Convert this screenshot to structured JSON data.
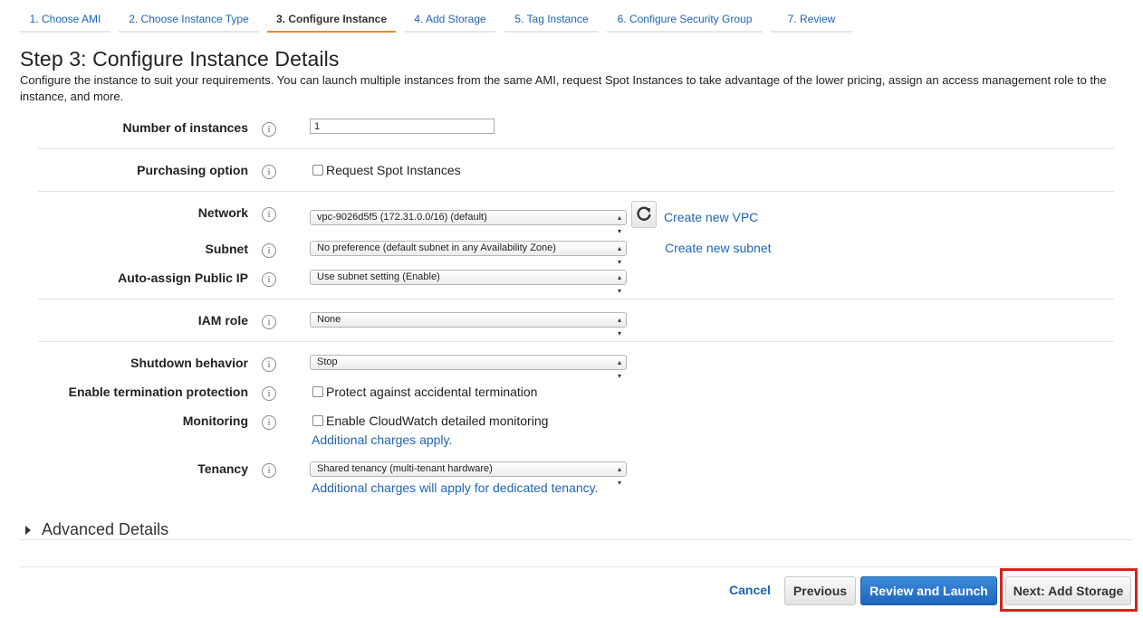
{
  "wizard": {
    "steps": [
      {
        "label": "1. Choose AMI"
      },
      {
        "label": "2. Choose Instance Type"
      },
      {
        "label": "3. Configure Instance"
      },
      {
        "label": "4. Add Storage"
      },
      {
        "label": "5. Tag Instance"
      },
      {
        "label": "6. Configure Security Group"
      },
      {
        "label": "7. Review"
      }
    ],
    "active_step": 3
  },
  "page": {
    "title": "Step 3: Configure Instance Details",
    "intro": "Configure the instance to suit your requirements. You can launch multiple instances from the same AMI, request Spot Instances to take advantage of the lower pricing, assign an access management role to the instance, and more."
  },
  "form": {
    "info_glyph": "i",
    "number_of_instances": {
      "label": "Number of instances",
      "value": "1"
    },
    "purchasing_option": {
      "label": "Purchasing option",
      "checkbox_label": "Request Spot Instances",
      "checked": false
    },
    "network": {
      "label": "Network",
      "value": "vpc-9026d5f5 (172.31.0.0/16) (default)",
      "link": "Create new VPC"
    },
    "subnet": {
      "label": "Subnet",
      "value": "No preference (default subnet in any Availability Zone)",
      "link": "Create new subnet"
    },
    "public_ip": {
      "label": "Auto-assign Public IP",
      "value": "Use subnet setting (Enable)"
    },
    "iam_role": {
      "label": "IAM role",
      "value": "None"
    },
    "shutdown": {
      "label": "Shutdown behavior",
      "value": "Stop"
    },
    "termination": {
      "label": "Enable termination protection",
      "checkbox_label": "Protect against accidental termination",
      "checked": false
    },
    "monitoring": {
      "label": "Monitoring",
      "checkbox_label": "Enable CloudWatch detailed monitoring",
      "checked": false,
      "note": "Additional charges apply."
    },
    "tenancy": {
      "label": "Tenancy",
      "value": "Shared tenancy (multi-tenant hardware)",
      "note": "Additional charges will apply for dedicated tenancy."
    }
  },
  "advanced": {
    "label": "Advanced Details"
  },
  "buttons": {
    "cancel": "Cancel",
    "previous": "Previous",
    "review_launch": "Review and Launch",
    "next": "Next: Add Storage"
  },
  "colors": {
    "accent": "#f08c1e",
    "link": "#1f65b5",
    "primary": "#1e66bd",
    "highlight": "#d3241c"
  }
}
